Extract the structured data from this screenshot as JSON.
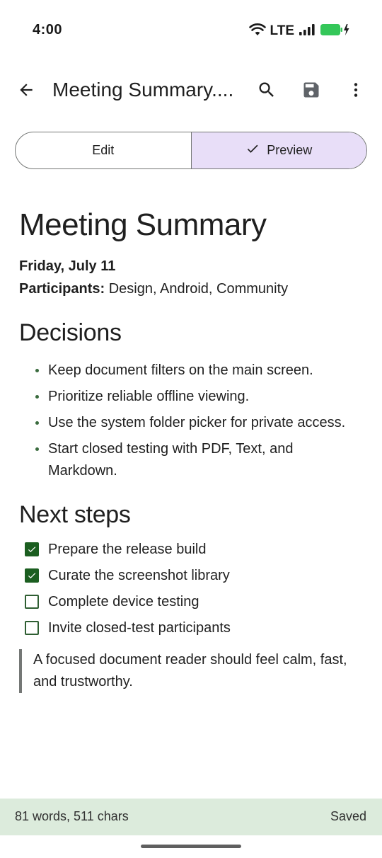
{
  "status_bar": {
    "time": "4:00",
    "network": "LTE",
    "icons": [
      "wifi-icon",
      "signal-icon",
      "battery-charging-icon"
    ],
    "battery_color": "#34c759"
  },
  "app_bar": {
    "title": "Meeting Summary....",
    "icons": [
      "back-arrow-icon",
      "search-icon",
      "save-icon",
      "more-vert-icon"
    ]
  },
  "tabs": {
    "edit_label": "Edit",
    "preview_label": "Preview",
    "selected": "Preview",
    "selected_color": "#e8def8"
  },
  "document": {
    "title": "Meeting Summary",
    "date": "Friday, July 11",
    "participants_label": "Participants:",
    "participants_value": " Design, Android, Community",
    "decisions_heading": "Decisions",
    "decisions": [
      "Keep document filters on the main screen.",
      "Prioritize reliable offline viewing.",
      "Use the system folder picker for private access.",
      "Start closed testing with PDF, Text, and Markdown."
    ],
    "next_steps_heading": "Next steps",
    "tasks": [
      {
        "label": "Prepare the release build",
        "checked": true
      },
      {
        "label": "Curate the screenshot library",
        "checked": true
      },
      {
        "label": "Complete device testing",
        "checked": false
      },
      {
        "label": "Invite closed-test participants",
        "checked": false
      }
    ],
    "quote": "A focused document reader should feel calm, fast, and trustworthy."
  },
  "footer": {
    "count": "81 words, 511 chars",
    "status": "Saved",
    "background": "#dcebdc"
  }
}
